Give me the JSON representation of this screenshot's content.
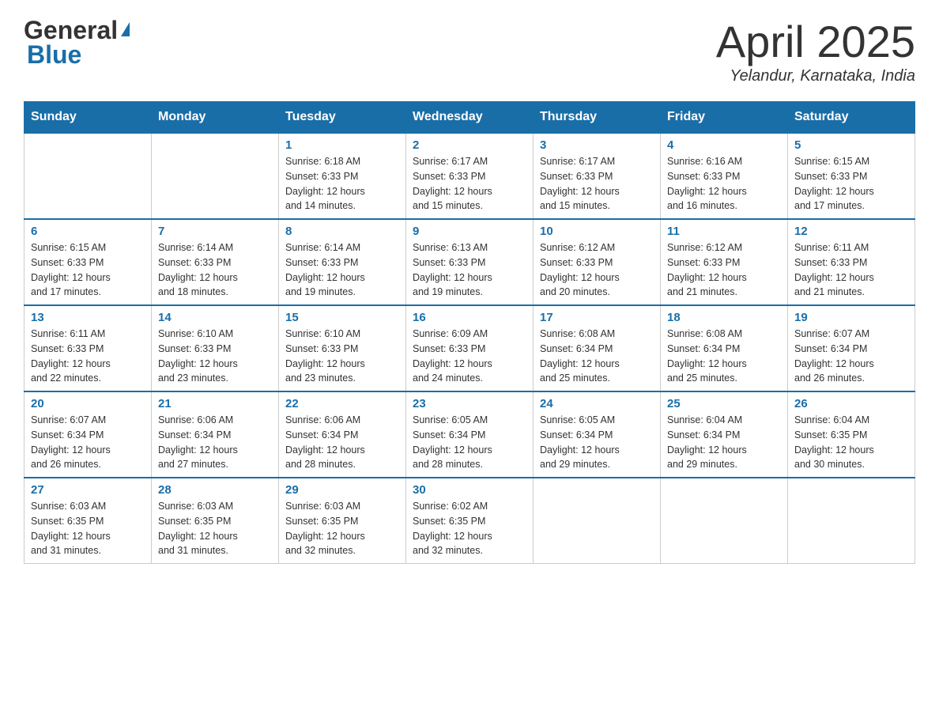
{
  "header": {
    "logo_general": "General",
    "logo_blue": "Blue",
    "month_title": "April 2025",
    "location": "Yelandur, Karnataka, India"
  },
  "days_of_week": [
    "Sunday",
    "Monday",
    "Tuesday",
    "Wednesday",
    "Thursday",
    "Friday",
    "Saturday"
  ],
  "weeks": [
    [
      {
        "day": "",
        "info": ""
      },
      {
        "day": "",
        "info": ""
      },
      {
        "day": "1",
        "info": "Sunrise: 6:18 AM\nSunset: 6:33 PM\nDaylight: 12 hours\nand 14 minutes."
      },
      {
        "day": "2",
        "info": "Sunrise: 6:17 AM\nSunset: 6:33 PM\nDaylight: 12 hours\nand 15 minutes."
      },
      {
        "day": "3",
        "info": "Sunrise: 6:17 AM\nSunset: 6:33 PM\nDaylight: 12 hours\nand 15 minutes."
      },
      {
        "day": "4",
        "info": "Sunrise: 6:16 AM\nSunset: 6:33 PM\nDaylight: 12 hours\nand 16 minutes."
      },
      {
        "day": "5",
        "info": "Sunrise: 6:15 AM\nSunset: 6:33 PM\nDaylight: 12 hours\nand 17 minutes."
      }
    ],
    [
      {
        "day": "6",
        "info": "Sunrise: 6:15 AM\nSunset: 6:33 PM\nDaylight: 12 hours\nand 17 minutes."
      },
      {
        "day": "7",
        "info": "Sunrise: 6:14 AM\nSunset: 6:33 PM\nDaylight: 12 hours\nand 18 minutes."
      },
      {
        "day": "8",
        "info": "Sunrise: 6:14 AM\nSunset: 6:33 PM\nDaylight: 12 hours\nand 19 minutes."
      },
      {
        "day": "9",
        "info": "Sunrise: 6:13 AM\nSunset: 6:33 PM\nDaylight: 12 hours\nand 19 minutes."
      },
      {
        "day": "10",
        "info": "Sunrise: 6:12 AM\nSunset: 6:33 PM\nDaylight: 12 hours\nand 20 minutes."
      },
      {
        "day": "11",
        "info": "Sunrise: 6:12 AM\nSunset: 6:33 PM\nDaylight: 12 hours\nand 21 minutes."
      },
      {
        "day": "12",
        "info": "Sunrise: 6:11 AM\nSunset: 6:33 PM\nDaylight: 12 hours\nand 21 minutes."
      }
    ],
    [
      {
        "day": "13",
        "info": "Sunrise: 6:11 AM\nSunset: 6:33 PM\nDaylight: 12 hours\nand 22 minutes."
      },
      {
        "day": "14",
        "info": "Sunrise: 6:10 AM\nSunset: 6:33 PM\nDaylight: 12 hours\nand 23 minutes."
      },
      {
        "day": "15",
        "info": "Sunrise: 6:10 AM\nSunset: 6:33 PM\nDaylight: 12 hours\nand 23 minutes."
      },
      {
        "day": "16",
        "info": "Sunrise: 6:09 AM\nSunset: 6:33 PM\nDaylight: 12 hours\nand 24 minutes."
      },
      {
        "day": "17",
        "info": "Sunrise: 6:08 AM\nSunset: 6:34 PM\nDaylight: 12 hours\nand 25 minutes."
      },
      {
        "day": "18",
        "info": "Sunrise: 6:08 AM\nSunset: 6:34 PM\nDaylight: 12 hours\nand 25 minutes."
      },
      {
        "day": "19",
        "info": "Sunrise: 6:07 AM\nSunset: 6:34 PM\nDaylight: 12 hours\nand 26 minutes."
      }
    ],
    [
      {
        "day": "20",
        "info": "Sunrise: 6:07 AM\nSunset: 6:34 PM\nDaylight: 12 hours\nand 26 minutes."
      },
      {
        "day": "21",
        "info": "Sunrise: 6:06 AM\nSunset: 6:34 PM\nDaylight: 12 hours\nand 27 minutes."
      },
      {
        "day": "22",
        "info": "Sunrise: 6:06 AM\nSunset: 6:34 PM\nDaylight: 12 hours\nand 28 minutes."
      },
      {
        "day": "23",
        "info": "Sunrise: 6:05 AM\nSunset: 6:34 PM\nDaylight: 12 hours\nand 28 minutes."
      },
      {
        "day": "24",
        "info": "Sunrise: 6:05 AM\nSunset: 6:34 PM\nDaylight: 12 hours\nand 29 minutes."
      },
      {
        "day": "25",
        "info": "Sunrise: 6:04 AM\nSunset: 6:34 PM\nDaylight: 12 hours\nand 29 minutes."
      },
      {
        "day": "26",
        "info": "Sunrise: 6:04 AM\nSunset: 6:35 PM\nDaylight: 12 hours\nand 30 minutes."
      }
    ],
    [
      {
        "day": "27",
        "info": "Sunrise: 6:03 AM\nSunset: 6:35 PM\nDaylight: 12 hours\nand 31 minutes."
      },
      {
        "day": "28",
        "info": "Sunrise: 6:03 AM\nSunset: 6:35 PM\nDaylight: 12 hours\nand 31 minutes."
      },
      {
        "day": "29",
        "info": "Sunrise: 6:03 AM\nSunset: 6:35 PM\nDaylight: 12 hours\nand 32 minutes."
      },
      {
        "day": "30",
        "info": "Sunrise: 6:02 AM\nSunset: 6:35 PM\nDaylight: 12 hours\nand 32 minutes."
      },
      {
        "day": "",
        "info": ""
      },
      {
        "day": "",
        "info": ""
      },
      {
        "day": "",
        "info": ""
      }
    ]
  ]
}
